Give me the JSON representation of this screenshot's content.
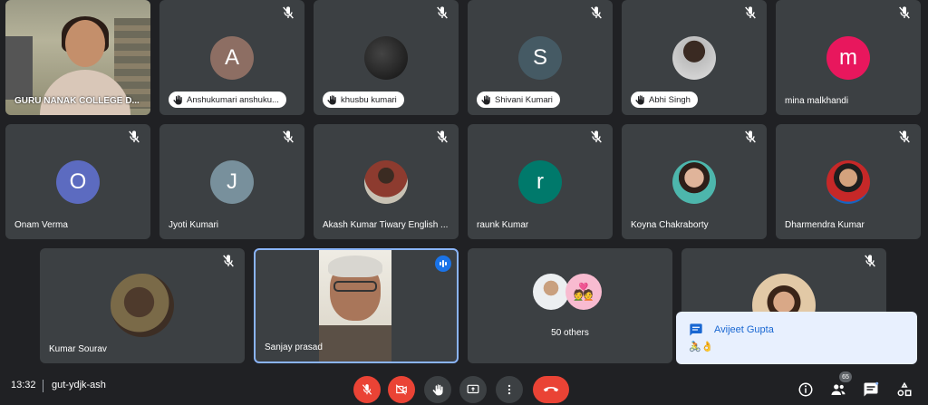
{
  "self_tile": {
    "label": "GURU NANAK COLLEGE D..."
  },
  "participants": [
    {
      "name": "Anshukumari anshuku...",
      "initial": "A",
      "color": "#8d6e63",
      "hand": true,
      "muted": true
    },
    {
      "name": "khusbu kumari",
      "initial": "",
      "color": "#111111",
      "hand": true,
      "muted": true
    },
    {
      "name": "Shivani Kumari",
      "initial": "S",
      "color": "#455a64",
      "hand": true,
      "muted": true
    },
    {
      "name": "Abhi Singh",
      "initial": "",
      "color": "#9e9e9e",
      "hand": true,
      "muted": true
    },
    {
      "name": "mina malkhandi",
      "initial": "m",
      "color": "#e8175d",
      "hand": false,
      "muted": true
    },
    {
      "name": "Onam Verma",
      "initial": "O",
      "color": "#5c6bc0",
      "hand": false,
      "muted": true
    },
    {
      "name": "Jyoti Kumari",
      "initial": "J",
      "color": "#78909c",
      "hand": false,
      "muted": true
    },
    {
      "name": "Akash Kumar Tiwary English ...",
      "initial": "",
      "color": "#6d4c41",
      "hand": false,
      "muted": true
    },
    {
      "name": "raunk Kumar",
      "initial": "r",
      "color": "#00796b",
      "hand": false,
      "muted": true
    },
    {
      "name": "Koyna Chakraborty",
      "initial": "",
      "color": "#4db6ac",
      "hand": false,
      "muted": true
    },
    {
      "name": "Dharmendra Kumar",
      "initial": "",
      "color": "#e57373",
      "hand": false,
      "muted": true
    },
    {
      "name": "Kumar Sourav",
      "initial": "",
      "color": "#5d4037",
      "hand": false,
      "muted": true
    },
    {
      "name": "Sanjay prasad",
      "initial": "",
      "color": "#a9765a",
      "hand": false,
      "muted": false,
      "speaking": true
    },
    {
      "name": "50 others",
      "initial": "",
      "color": "#9e9e9e",
      "hand": false,
      "muted": false
    },
    {
      "name": "",
      "initial": "",
      "color": "#c9a57a",
      "hand": false,
      "muted": true
    }
  ],
  "chat_popup": {
    "sender": "Avijeet Gupta",
    "message": "🚴👌"
  },
  "bottom_bar": {
    "time": "13:32",
    "meeting_code": "gut-ydjk-ash",
    "people_count": "65"
  },
  "colors": {
    "background": "#202124",
    "tile": "#3c4043",
    "danger": "#ea4335",
    "accent": "#1a73e8"
  },
  "icons": [
    "mic-off-icon",
    "raised-hand-icon",
    "speaking-icon",
    "video-off-icon",
    "present-icon",
    "more-options-icon",
    "end-call-icon",
    "info-icon",
    "people-icon",
    "chat-icon",
    "activities-icon"
  ]
}
